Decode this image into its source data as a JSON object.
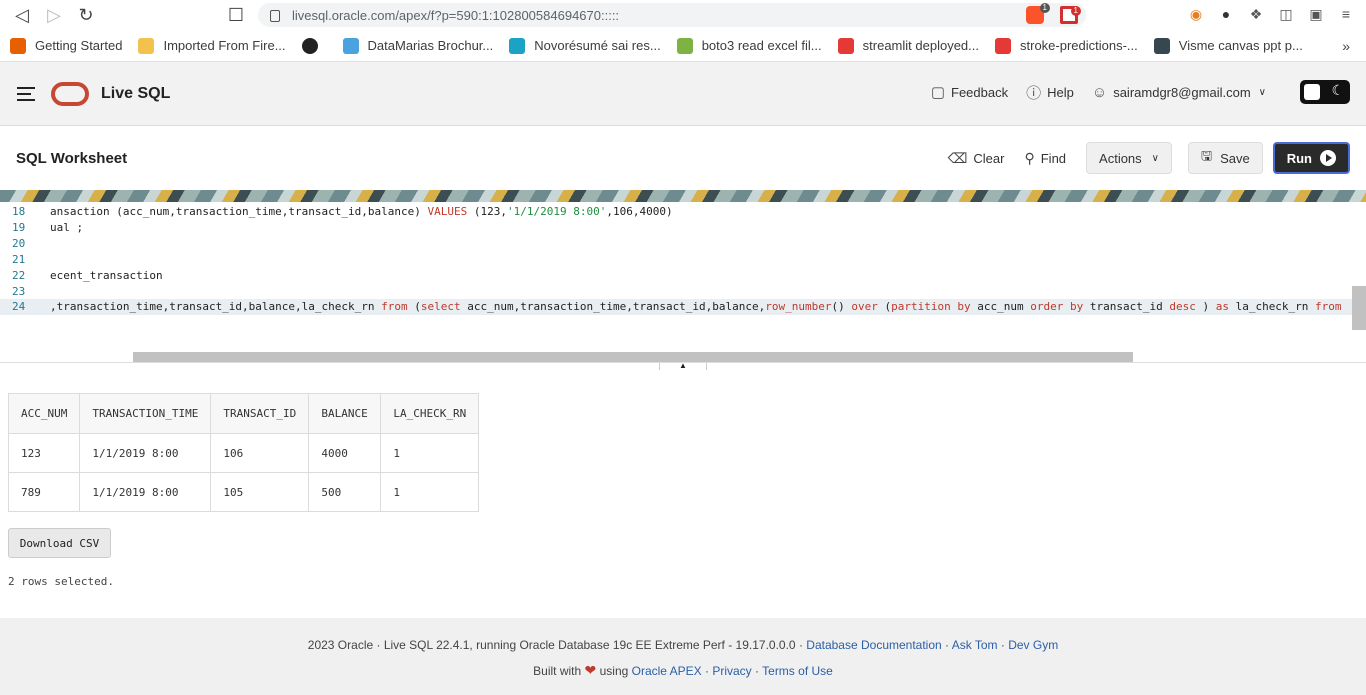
{
  "browser": {
    "url": "livesql.oracle.com/apex/f?p=590:1:102800584694670:::::",
    "bookmarks": [
      {
        "label": "Getting Started",
        "icon": "firefox-icon",
        "color": "#e66000"
      },
      {
        "label": "Imported From Fire...",
        "icon": "folder-icon",
        "color": "#f2c14e"
      },
      {
        "label": "",
        "icon": "github-icon",
        "color": "#222222"
      },
      {
        "label": "DataMarias Brochur...",
        "icon": "page-icon",
        "color": "#4aa3df"
      },
      {
        "label": "Novorésumé sai res...",
        "icon": "novoresume-icon",
        "color": "#1aa3c5"
      },
      {
        "label": "boto3 read excel fil...",
        "icon": "bolt-icon",
        "color": "#7cb342"
      },
      {
        "label": "streamlit deployed...",
        "icon": "crown-icon",
        "color": "#e53935"
      },
      {
        "label": "stroke-predictions-...",
        "icon": "crown-icon",
        "color": "#e53935"
      },
      {
        "label": "Visme canvas ppt p...",
        "icon": "visme-icon",
        "color": "#37474f"
      }
    ],
    "badges": {
      "brave": "1",
      "alert": "1"
    }
  },
  "header": {
    "app_title": "Live SQL",
    "feedback": "Feedback",
    "help": "Help",
    "user": "sairamdgr8@gmail.com"
  },
  "worksheet": {
    "title": "SQL Worksheet",
    "clear": "Clear",
    "find": "Find",
    "actions": "Actions",
    "save": "Save",
    "run": "Run"
  },
  "editor": {
    "lines": [
      {
        "num": "18",
        "text": "ansaction (acc_num,transaction_time,transact_id,balance) VALUES (123,'1/1/2019 8:00',106,4000)"
      },
      {
        "num": "19",
        "text": "ual ;"
      },
      {
        "num": "20",
        "text": ""
      },
      {
        "num": "21",
        "text": ""
      },
      {
        "num": "22",
        "text": "ecent_transaction"
      },
      {
        "num": "23",
        "text": ""
      },
      {
        "num": "24",
        "text": ",transaction_time,transact_id,balance,la_check_rn from (select acc_num,transaction_time,transact_id,balance,row_number() over (partition by acc_num order by transact_id desc )   as  la_check_rn from"
      }
    ]
  },
  "results": {
    "columns": [
      "ACC_NUM",
      "TRANSACTION_TIME",
      "TRANSACT_ID",
      "BALANCE",
      "LA_CHECK_RN"
    ],
    "rows": [
      [
        "123",
        "1/1/2019 8:00",
        "106",
        "4000",
        "1"
      ],
      [
        "789",
        "1/1/2019 8:00",
        "105",
        "500",
        "1"
      ]
    ],
    "download": "Download CSV",
    "summary": "2 rows selected."
  },
  "footer": {
    "line1": "2023 Oracle · Live SQL 22.4.1, running Oracle Database 19c EE Extreme Perf - 19.17.0.0.0 ·",
    "db_docs": "Database Documentation",
    "ask_tom": "Ask Tom",
    "dev_gym": "Dev Gym",
    "built_with": "Built with",
    "using": "using",
    "apex": "Oracle APEX",
    "privacy": "Privacy",
    "terms": "Terms of Use"
  }
}
